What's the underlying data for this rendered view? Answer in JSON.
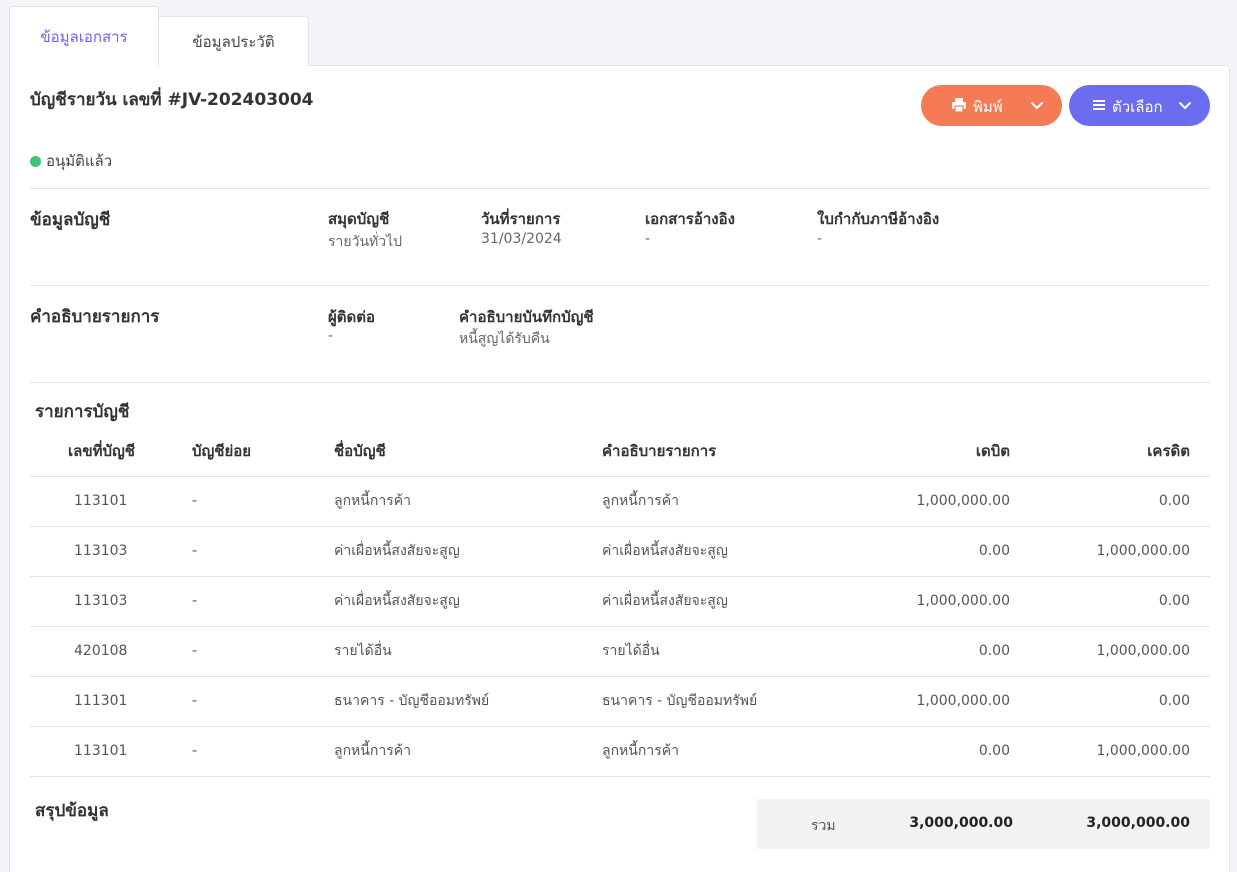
{
  "tabs": [
    {
      "label": "ข้อมูลเอกสาร",
      "active": true
    },
    {
      "label": "ข้อมูลประวัติ",
      "active": false
    }
  ],
  "header": {
    "title": "บัญชีรายวัน เลขที่ #JV-202403004",
    "status": "อนุมัติแล้ว",
    "status_color": "#3fc47a",
    "print_button": {
      "label": "พิมพ์",
      "icon": "printer-icon",
      "color": "#f47b56"
    },
    "options_button": {
      "label": "ตัวเลือก",
      "icon": "menu-icon",
      "color": "#6b6cf0"
    }
  },
  "account_info": {
    "section_title": "ข้อมูลบัญชี",
    "fields": [
      {
        "label": "สมุดบัญชี",
        "value": "รายวันทั่วไป"
      },
      {
        "label": "วันที่รายการ",
        "value": "31/03/2024"
      },
      {
        "label": "เอกสารอ้างอิง",
        "value": "-"
      },
      {
        "label": "ใบกำกับภาษีอ้างอิง",
        "value": "-"
      }
    ]
  },
  "description_info": {
    "section_title": "คำอธิบายรายการ",
    "fields": [
      {
        "label": "ผู้ติดต่อ",
        "value": "-"
      },
      {
        "label": "คำอธิบายบันทึกบัญชี",
        "value": "หนี้สูญได้รับคืน"
      }
    ]
  },
  "entries": {
    "section_title": "รายการบัญชี",
    "columns": [
      "เลขที่บัญชี",
      "บัญชีย่อย",
      "ชื่อบัญชี",
      "คำอธิบายรายการ",
      "เดบิต",
      "เครดิต"
    ],
    "rows": [
      {
        "account_no": "113101",
        "sub_account": "-",
        "account_name": "ลูกหนี้การค้า",
        "description": "ลูกหนี้การค้า",
        "debit": "1,000,000.00",
        "credit": "0.00"
      },
      {
        "account_no": "113103",
        "sub_account": "-",
        "account_name": "ค่าเผื่อหนี้สงสัยจะสูญ",
        "description": "ค่าเผื่อหนี้สงสัยจะสูญ",
        "debit": "0.00",
        "credit": "1,000,000.00"
      },
      {
        "account_no": "113103",
        "sub_account": "-",
        "account_name": "ค่าเผื่อหนี้สงสัยจะสูญ",
        "description": "ค่าเผื่อหนี้สงสัยจะสูญ",
        "debit": "1,000,000.00",
        "credit": "0.00"
      },
      {
        "account_no": "420108",
        "sub_account": "-",
        "account_name": "รายได้อื่น",
        "description": "รายได้อื่น",
        "debit": "0.00",
        "credit": "1,000,000.00"
      },
      {
        "account_no": "111301",
        "sub_account": "-",
        "account_name": "ธนาคาร - บัญชีออมทรัพย์",
        "description": "ธนาคาร - บัญชีออมทรัพย์",
        "debit": "1,000,000.00",
        "credit": "0.00"
      },
      {
        "account_no": "113101",
        "sub_account": "-",
        "account_name": "ลูกหนี้การค้า",
        "description": "ลูกหนี้การค้า",
        "debit": "0.00",
        "credit": "1,000,000.00"
      }
    ]
  },
  "summary": {
    "section_title": "สรุปข้อมูล",
    "total_label": "รวม",
    "total_debit": "3,000,000.00",
    "total_credit": "3,000,000.00"
  }
}
